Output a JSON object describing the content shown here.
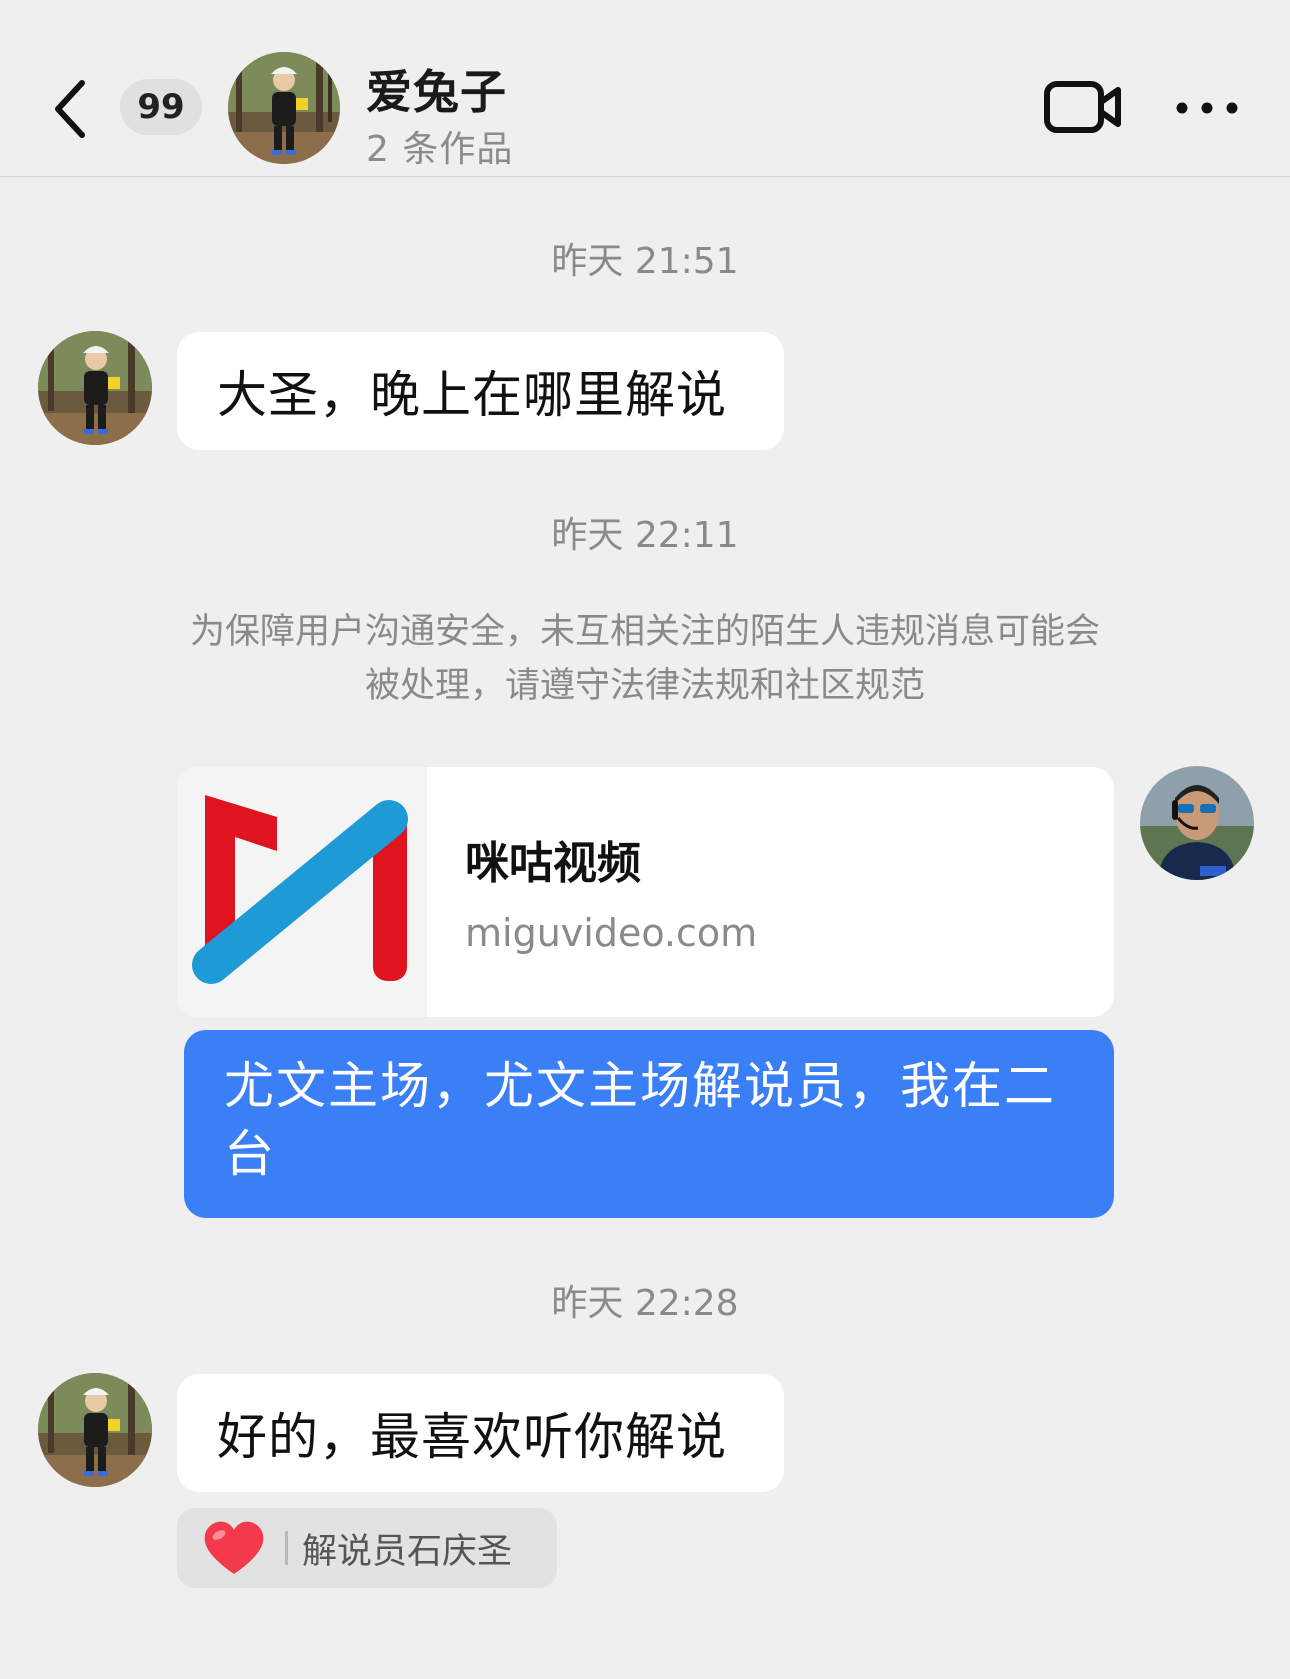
{
  "header": {
    "badge_count": "99",
    "contact_name": "爱兔子",
    "contact_subtitle": "2 条作品",
    "icons": [
      "back-arrow-icon",
      "video-call-icon",
      "more-icon"
    ]
  },
  "messages": {
    "ts1": "昨天 21:51",
    "msg1": "大圣，晚上在哪里解说",
    "ts2": "昨天 22:11",
    "notice_line1": "为保障用户沟通安全，未互相关注的陌生人违规消息可能会",
    "notice_line2": "被处理，请遵守法律法规和社区规范",
    "link_title": "咪咕视频",
    "link_domain": "miguvideo.com",
    "msg2": "尤文主场，尤文主场解说员，我在二台",
    "ts3": "昨天 22:28",
    "msg3": "好的，最喜欢听你解说",
    "reaction_name": "解说员石庆圣"
  },
  "colors": {
    "background": "#efefef",
    "outgoing_bubble": "#3a7ff6",
    "incoming_bubble": "#ffffff",
    "timestamp_text": "#8a8a8a",
    "logo_red": "#e0141e",
    "logo_blue": "#1e9ad6",
    "reaction_heart": "#f23a4a"
  }
}
